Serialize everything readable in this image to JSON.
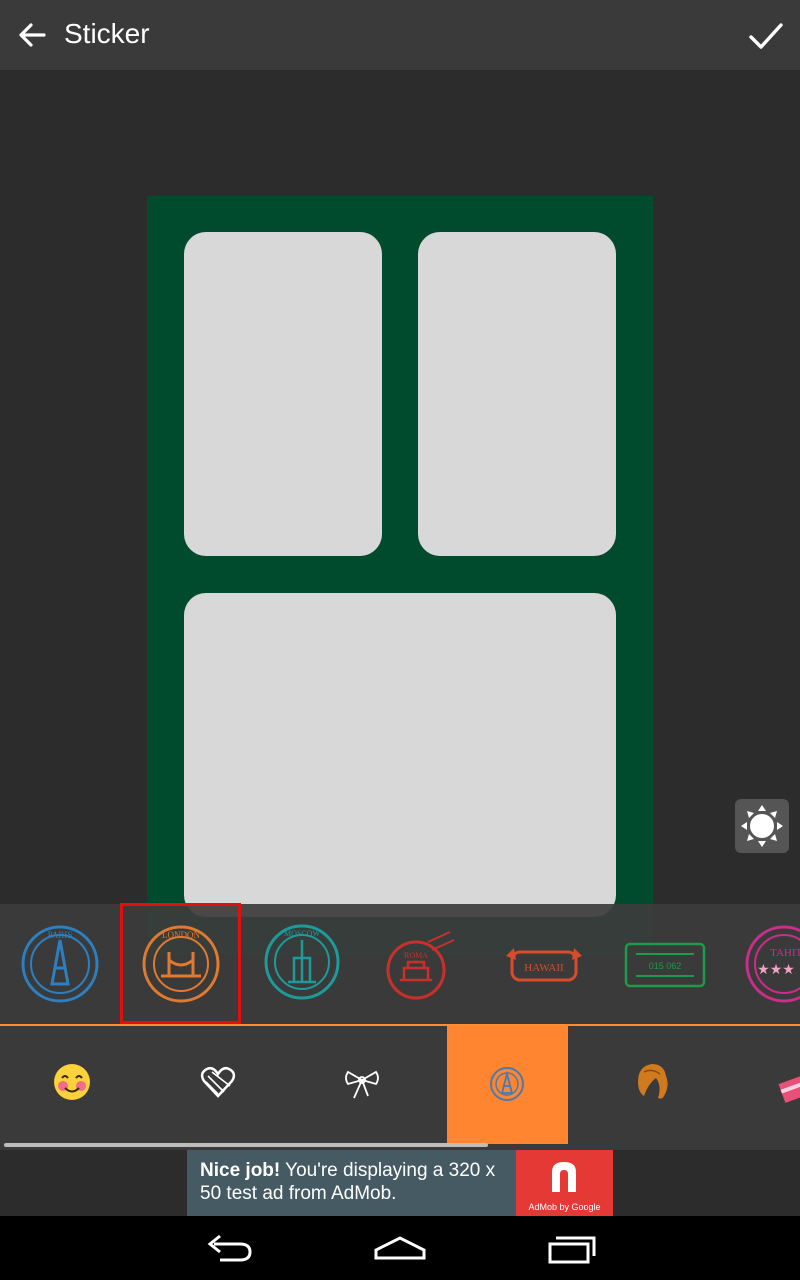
{
  "header": {
    "title": "Sticker",
    "back_icon": "arrow-back-icon",
    "confirm_icon": "checkmark-icon"
  },
  "collage": {
    "background_color": "#004a2e",
    "cell_color": "#d8d8d8"
  },
  "brightness_button": {
    "icon": "brightness-icon"
  },
  "stickers": [
    {
      "name": "paris-stamp",
      "color": "#2d7fbf",
      "text": "PARIS"
    },
    {
      "name": "london-stamp",
      "color": "#e07a30",
      "text": "LONDON",
      "selected": true
    },
    {
      "name": "moscow-stamp",
      "color": "#1e9a9a",
      "text": "MOSCOW"
    },
    {
      "name": "rome-stamp",
      "color": "#c9302c",
      "text": "ROMA"
    },
    {
      "name": "hawaii-stamp",
      "color": "#d84c2c",
      "text": "HAWAII"
    },
    {
      "name": "arabic-stamp",
      "color": "#1e9a4c",
      "text": "015 062"
    },
    {
      "name": "tahiti-stamp",
      "color": "#c82e8a",
      "text": "TAHITI"
    }
  ],
  "categories": [
    {
      "name": "emoji-category",
      "icon": "smiley-face-icon"
    },
    {
      "name": "hearts-category",
      "icon": "heart-icon"
    },
    {
      "name": "bows-category",
      "icon": "bow-icon"
    },
    {
      "name": "stamps-category",
      "icon": "stamp-icon",
      "active": true
    },
    {
      "name": "hair-category",
      "icon": "hair-icon"
    },
    {
      "name": "gifts-category",
      "icon": "gift-icon"
    }
  ],
  "ad": {
    "headline": "Nice job!",
    "body": " You're displaying a 320 x 50 test ad from AdMob.",
    "logo_caption": "AdMob by Google"
  },
  "navbar": {
    "back": "nav-back-icon",
    "home": "nav-home-icon",
    "recents": "nav-recents-icon"
  },
  "colors": {
    "accent": "#ff8530",
    "selection": "#e01010"
  }
}
